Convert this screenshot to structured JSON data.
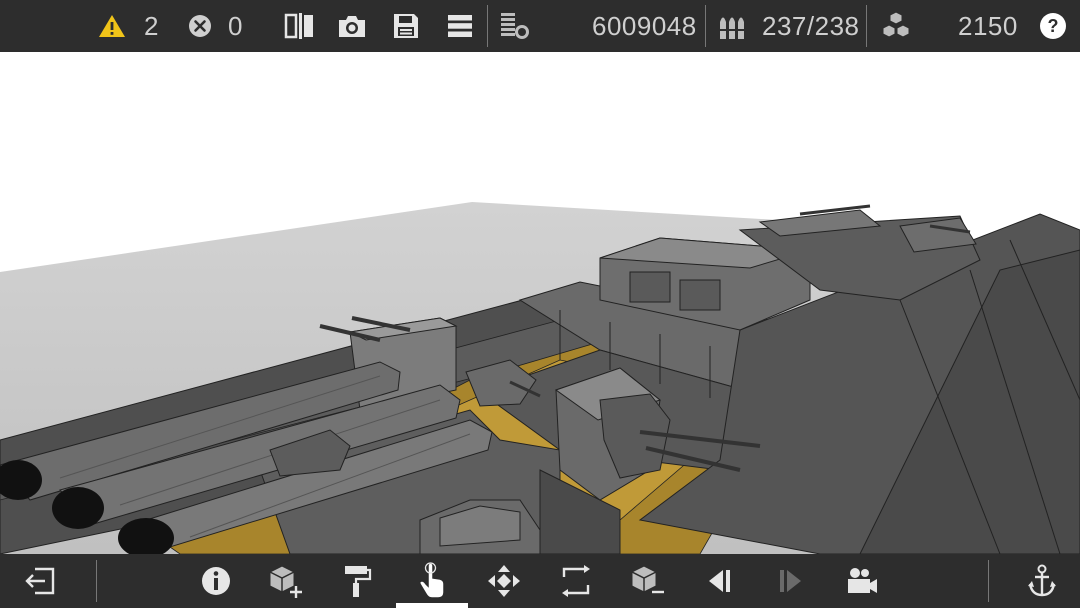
{
  "status": {
    "warnings_count": "2",
    "errors_count": "0",
    "cost_value": "6009048",
    "ammo_value": "237/238",
    "blocks_value": "2150",
    "help_label": "?"
  },
  "icons": {
    "warning": "warning-triangle-icon",
    "error": "error-x-circle-icon",
    "split_view": "split-view-icon",
    "screenshot": "camera-icon",
    "save": "floppy-disk-icon",
    "menu": "hamburger-menu-icon",
    "cost": "coin-stack-icon",
    "ammo": "ammo-shells-icon",
    "blocks": "cubes-icon",
    "help": "help-icon"
  },
  "toolbar": {
    "items": [
      {
        "name": "exit",
        "icon": "exit-icon"
      },
      {
        "name": "info",
        "icon": "info-icon"
      },
      {
        "name": "add-block",
        "icon": "add-cube-icon"
      },
      {
        "name": "paint",
        "icon": "paint-roller-icon"
      },
      {
        "name": "select",
        "icon": "hand-pointer-icon",
        "active": true
      },
      {
        "name": "move",
        "icon": "move-arrows-icon"
      },
      {
        "name": "rotate",
        "icon": "rotate-icon"
      },
      {
        "name": "remove-block",
        "icon": "remove-cube-icon"
      },
      {
        "name": "undo",
        "icon": "step-back-icon"
      },
      {
        "name": "redo",
        "icon": "step-forward-icon"
      },
      {
        "name": "camera",
        "icon": "video-camera-icon"
      },
      {
        "name": "anchor",
        "icon": "anchor-icon"
      }
    ]
  },
  "colors": {
    "bar_bg": "#2d2d2d",
    "warning_yellow": "#f0c419",
    "icon_light": "#e6e6e6",
    "hull_grey": "#5a5a5a",
    "deck_gold": "#b08a2e"
  }
}
